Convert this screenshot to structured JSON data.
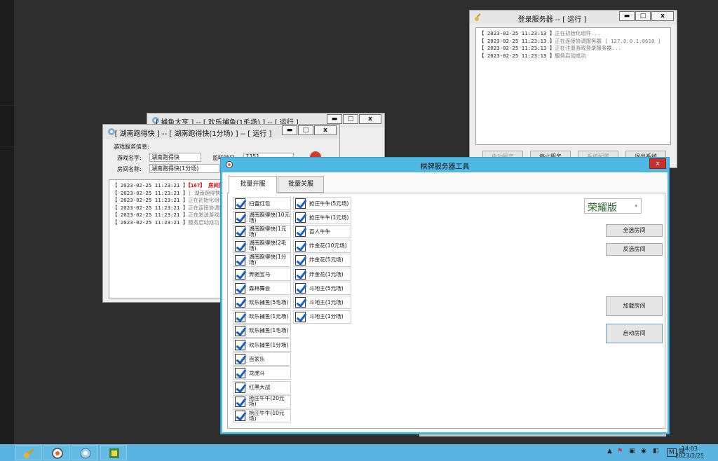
{
  "login_window": {
    "title": "登录服务器 -- [ 运行 ]",
    "minimize": "▬",
    "maximize": "□",
    "close": "x",
    "log": [
      {
        "time": "【 2023-02-25 11:23:13 】",
        "msg": "正在初始化组件..."
      },
      {
        "time": "【 2023-02-25 11:23:13 】",
        "msg": "正在连接协调服务器 [ 127.0.0.1:8610 ]"
      },
      {
        "time": "【 2023-02-25 11:23:13 】",
        "msg": "正在注册游戏登录服务器..."
      },
      {
        "time": "【 2023-02-25 11:23:13 】",
        "msg": "服务启动成功"
      }
    ],
    "buttons": [
      "启动服务",
      "停止服务",
      "系统配置",
      "退出系统"
    ]
  },
  "fishing_window": {
    "title": "[ 捕鱼大亨 ] -- [ 欢乐捕鱼(1毛场) ] -- [ 运行 ]",
    "minimize": "▬",
    "maximize": "□",
    "close": "x"
  },
  "hunan_window": {
    "title": "[ 湖南跑得快 ] -- [ 湖南跑得快(1分场) ] -- [ 运行 ]",
    "minimize": "▬",
    "maximize": "□",
    "close": "x",
    "group_label": "游戏服务信息:",
    "game_name_label": "游戏名字:",
    "game_name_value": "湖南跑得快",
    "port_label": "监听端口:",
    "port_value": "7351",
    "room_name_label": "房间名称:",
    "room_name_value": "湖南跑得快(1分场)",
    "log": [
      {
        "time": "【 2023-02-25 11:23:21 】",
        "msg": "【167】 房间加",
        "hl": true
      },
      {
        "time": "【 2023-02-25 11:23:21 】",
        "msg": "[ 湖南跑得快(1"
      },
      {
        "time": "【 2023-02-25 11:23:21 】",
        "msg": "正在初始化组件"
      },
      {
        "time": "【 2023-02-25 11:23:21 】",
        "msg": "正在连接协调服"
      },
      {
        "time": "【 2023-02-25 11:23:21 】",
        "msg": "正在发送游戏房"
      },
      {
        "time": "【 2023-02-25 11:23:21 】",
        "msg": "服务启动成功"
      }
    ]
  },
  "tool_window": {
    "title": "棋牌服务器工具",
    "close": "x",
    "tabs": [
      "批量开服",
      "批量关服"
    ],
    "edition": "荣耀版",
    "col1": [
      "扫雷红包",
      "湖南跑得快(10元场)",
      "湖南跑得快(1元场)",
      "湖南跑得快(2毛场)",
      "湖南跑得快(1分场)",
      "奔驰宝马",
      "森林舞会",
      "欢乐捕鱼(5毛场)",
      "欢乐捕鱼(1元场)",
      "欢乐捕鱼(1毛场)",
      "欢乐捕鱼(1分场)",
      "百家乐",
      "龙虎斗",
      "红黑大战",
      "抢庄牛牛(20元场)",
      "抢庄牛牛(10元场)"
    ],
    "col2": [
      "抢庄牛牛(5元场)",
      "抢庄牛牛(1元场)",
      "百人牛牛",
      "炸金花(10元场)",
      "炸金花(5元场)",
      "炸金花(1元场)",
      "斗地主(5元场)",
      "斗地主(1元场)",
      "斗地主(1分场)"
    ],
    "buttons": {
      "select_all": "全选房间",
      "invert": "反选房间",
      "load": "加载房间",
      "start": "启动房间"
    }
  },
  "taskbar": {
    "tray_m": "M",
    "time": "14:03",
    "date": "2023/2/25"
  }
}
